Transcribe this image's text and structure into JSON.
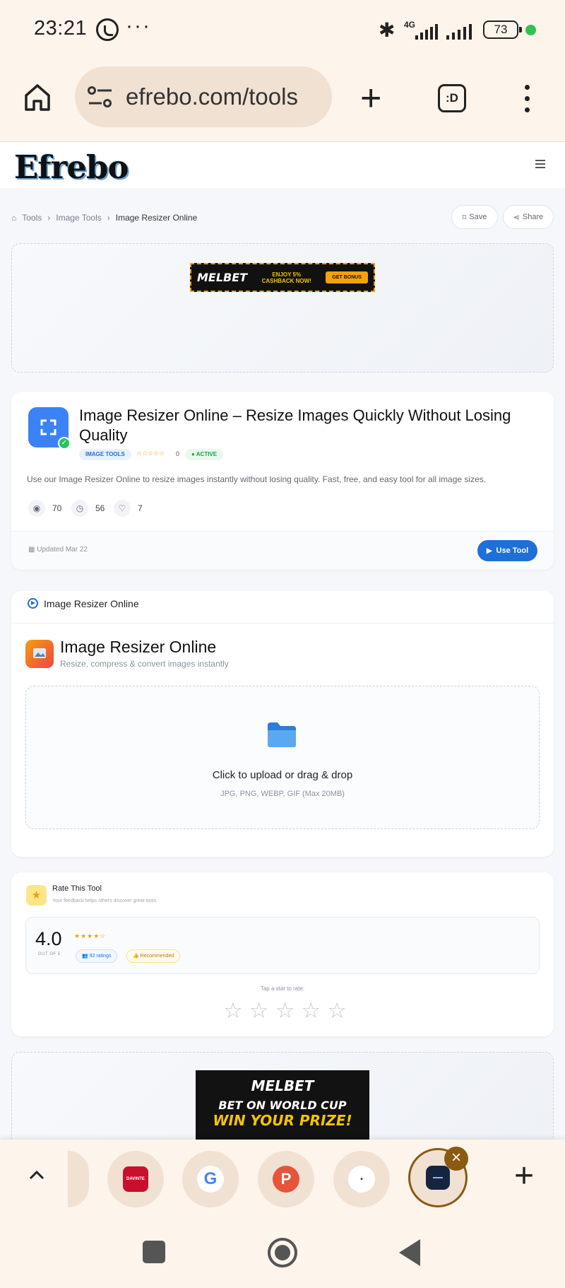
{
  "status_bar": {
    "time": "23:21",
    "network": "4G",
    "battery": "73",
    "icons": [
      "whatsapp-icon",
      "more-dots-icon",
      "bluetooth-icon",
      "signal-icon",
      "battery-icon"
    ]
  },
  "browser": {
    "url": "efrebo.com/tools",
    "tab_count_label": ":D"
  },
  "site": {
    "logo": "Efrebo"
  },
  "breadcrumb": {
    "items": [
      "Tools",
      "Image Tools",
      "Image Resizer Online"
    ],
    "save_label": "Save",
    "share_label": "Share"
  },
  "ad_top": {
    "brand": "MELBET",
    "text": "ENJOY 5% CASHBACK NOW!",
    "button": "GET BONUS"
  },
  "tool_card": {
    "title": "Image Resizer Online – Resize Images Quickly Without Losing Quality",
    "category_badge": "IMAGE TOOLS",
    "stars": "☆☆☆☆☆",
    "rating_count": "0",
    "status_badge": "● ACTIVE",
    "description": "Use our Image Resizer Online to resize images instantly without losing quality. Fast, free, and easy tool for all image sizes.",
    "views": "70",
    "time_stat": "56",
    "likes": "7",
    "updated": "Updated Mar 22",
    "use_tool_label": "Use Tool"
  },
  "tool_panel": {
    "header": "Image Resizer Online",
    "title": "Image Resizer Online",
    "subtitle": "Resize, compress & convert images instantly",
    "upload_text": "Click to upload or drag & drop",
    "upload_hint": "JPG, PNG, WEBP, GIF (Max 20MB)"
  },
  "rating_card": {
    "title": "Rate This Tool",
    "subtitle": "Your feedback helps others discover great tools",
    "score": "4.0",
    "out_of": "OUT OF 5",
    "mini_stars": "★★★★☆",
    "ratings": "92 ratings",
    "recommended": "Recommended",
    "tap_prompt": "Tap a star to rate:",
    "star_count": 5
  },
  "ad_bottom": {
    "brand": "MELBET",
    "line1": "BET ON WORLD CUP",
    "line2": "WIN YOUR PRIZE!"
  },
  "tab_strip": {
    "tabs": [
      {
        "name": "tab-davinte",
        "label": "DAVINTE",
        "bg": "#c8102e",
        "fg": "#ffffff"
      },
      {
        "name": "tab-google",
        "label": "G",
        "bg": "#ffffff",
        "fg": "#4285f4"
      },
      {
        "name": "tab-p",
        "label": "P",
        "bg": "#e8543a",
        "fg": "#ffffff"
      },
      {
        "name": "tab-site",
        "label": "•",
        "bg": "#ffffff",
        "fg": "#333333"
      }
    ]
  },
  "colors": {
    "accent": "#1f6fd8",
    "success": "#22c55e",
    "star": "#f59e0b",
    "tab_active_border": "#8a5a12"
  }
}
